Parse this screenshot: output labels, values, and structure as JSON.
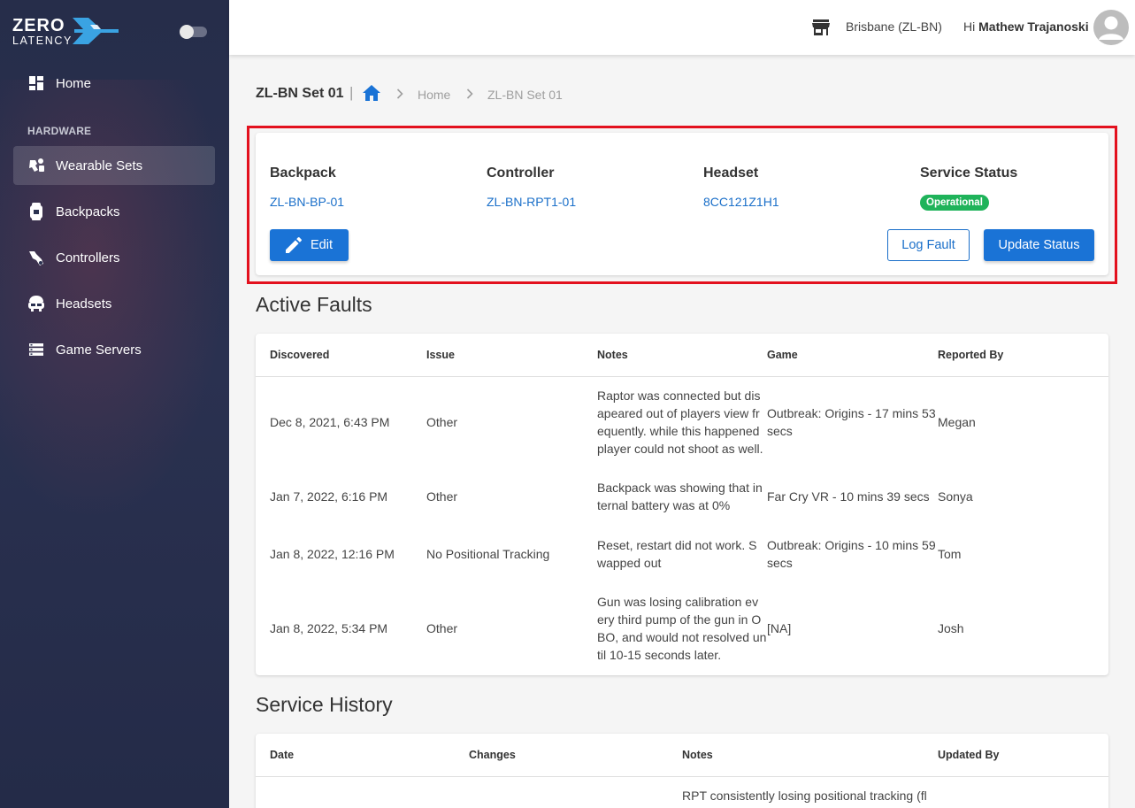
{
  "brand": {
    "line1": "ZERO",
    "line2": "LATENCY"
  },
  "sidebar": {
    "home_label": "Home",
    "section_label": "HARDWARE",
    "items": [
      {
        "label": "Wearable Sets",
        "icon": "wearable-sets-icon",
        "active": true
      },
      {
        "label": "Backpacks",
        "icon": "backpack-icon",
        "active": false
      },
      {
        "label": "Controllers",
        "icon": "controller-icon",
        "active": false
      },
      {
        "label": "Headsets",
        "icon": "headset-icon",
        "active": false
      },
      {
        "label": "Game Servers",
        "icon": "server-icon",
        "active": false
      }
    ]
  },
  "topbar": {
    "location": "Brisbane (ZL-BN)",
    "greeting_prefix": "Hi",
    "user_name": "Mathew Trajanoski"
  },
  "page": {
    "title": "ZL-BN Set 01",
    "separator": "|",
    "breadcrumb": [
      "Home",
      "ZL-BN Set 01"
    ]
  },
  "summary": {
    "headers": {
      "backpack": "Backpack",
      "controller": "Controller",
      "headset": "Headset",
      "status": "Service Status"
    },
    "backpack": "ZL-BN-BP-01",
    "controller": "ZL-BN-RPT1-01",
    "headset": "8CC121Z1H1",
    "status": "Operational",
    "status_color": "#1fb35a",
    "edit_label": "Edit",
    "log_fault_label": "Log Fault",
    "update_status_label": "Update Status"
  },
  "faults": {
    "title": "Active Faults",
    "columns": [
      "Discovered",
      "Issue",
      "Notes",
      "Game",
      "Reported By"
    ],
    "rows": [
      {
        "discovered": "Dec 8, 2021, 6:43 PM",
        "issue": "Other",
        "notes": [
          "Raptor was connected but dis",
          "apeared out of players view fr",
          "equently. while this happened",
          "player could not shoot as well."
        ],
        "game": [
          "Outbreak: Origins - 17 mins 53",
          "secs"
        ],
        "reported_by": "Megan"
      },
      {
        "discovered": "Jan 7, 2022, 6:16 PM",
        "issue": "Other",
        "notes": [
          "Backpack was showing that in",
          "ternal battery was at 0%"
        ],
        "game": [
          "Far Cry VR - 10 mins 39 secs"
        ],
        "reported_by": "Sonya"
      },
      {
        "discovered": "Jan 8, 2022, 12:16 PM",
        "issue": "No Positional Tracking",
        "notes": [
          "Reset, restart did not work. S",
          "wapped out"
        ],
        "game": [
          "Outbreak: Origins - 10 mins 59",
          "secs"
        ],
        "reported_by": "Tom"
      },
      {
        "discovered": "Jan 8, 2022, 5:34 PM",
        "issue": "Other",
        "notes": [
          "Gun was losing calibration ev",
          "ery third pump of the gun in O",
          "BO, and would not resolved un",
          "til 10-15 seconds later."
        ],
        "game": [
          "[NA]"
        ],
        "reported_by": "Josh"
      }
    ]
  },
  "history": {
    "title": "Service History",
    "columns": [
      "Date",
      "Changes",
      "Notes",
      "Updated By"
    ],
    "rows": [
      {
        "notes_first_line": "RPT consistently losing positional tracking (fl"
      }
    ]
  }
}
